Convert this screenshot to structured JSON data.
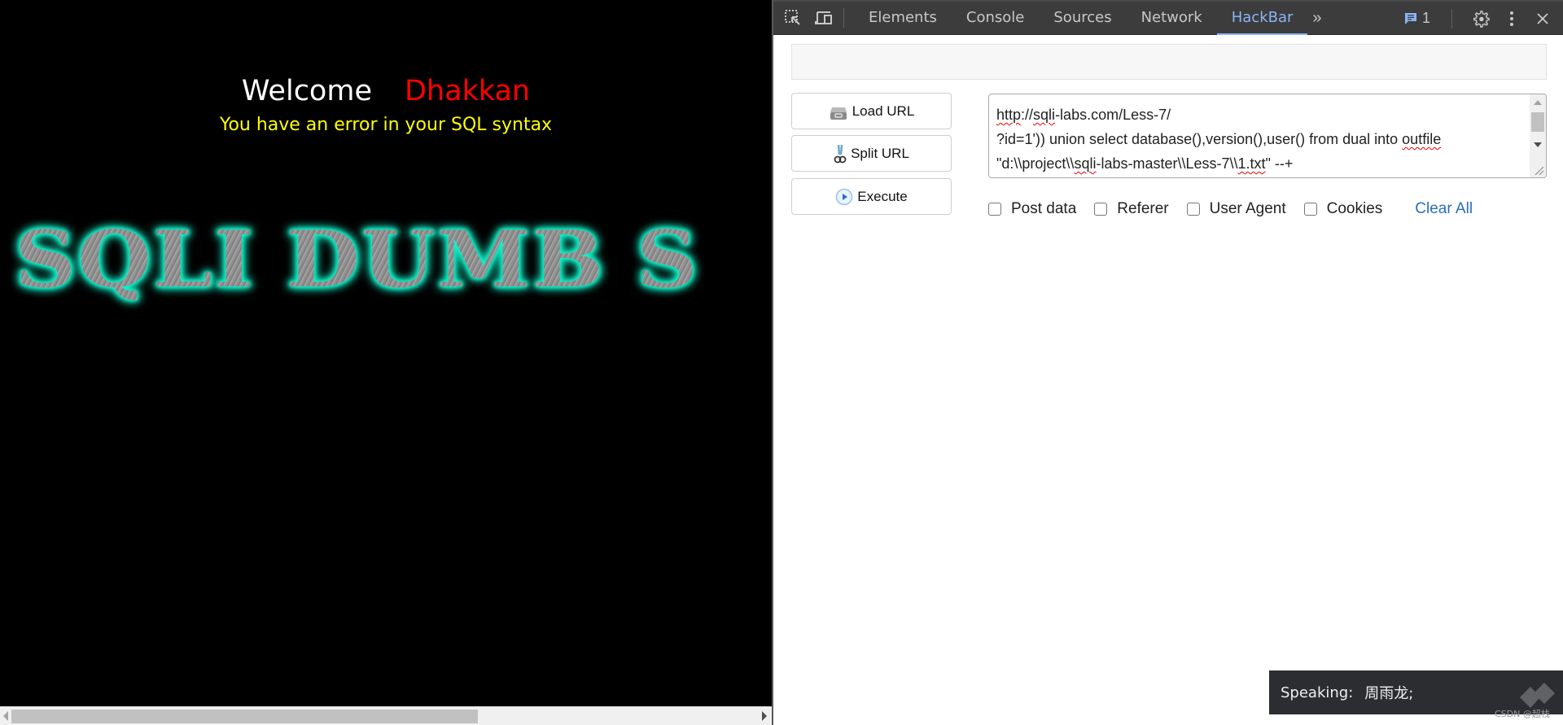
{
  "page": {
    "welcome_label": "Welcome",
    "welcome_name": "Dhakkan",
    "error_message": "You have an error in your SQL syntax",
    "banner_text": "SQLI DUMB S",
    "colors": {
      "welcome": "#ffffff",
      "name": "#ff0000",
      "error": "#ffff00",
      "banner_glow": "#1de9c4"
    }
  },
  "devtools": {
    "toolbar": {
      "inspect_icon": "inspect-element-icon",
      "device_icon": "device-toolbar-icon",
      "tabs": [
        {
          "label": "Elements",
          "active": false
        },
        {
          "label": "Console",
          "active": false
        },
        {
          "label": "Sources",
          "active": false
        },
        {
          "label": "Network",
          "active": false
        },
        {
          "label": "HackBar",
          "active": true
        }
      ],
      "more_tabs": "»",
      "issues_count": "1",
      "settings_icon": "gear-icon",
      "menu_icon": "kebab-menu-icon",
      "close_icon": "close-icon"
    },
    "hackbar": {
      "buttons": {
        "load_url": "Load URL",
        "split_url": "Split URL",
        "execute": "Execute"
      },
      "url_value": {
        "line1_a": "http",
        "line1_b": "://",
        "line1_c": "sqli",
        "line1_d": "-labs.com/Less-7/",
        "line2_a": "?id=1')) union select database(),version(),user() from dual into ",
        "line2_b": "outfile",
        "line3_a": "\"d:\\\\project\\\\",
        "line3_b": "sqli",
        "line3_c": "-labs-master\\\\Less-7\\\\",
        "line3_d": "1.txt",
        "line3_e": "\" --+"
      },
      "options": [
        {
          "label": "Post data",
          "checked": false
        },
        {
          "label": "Referer",
          "checked": false
        },
        {
          "label": "User Agent",
          "checked": false
        },
        {
          "label": "Cookies",
          "checked": false
        }
      ],
      "clear_all": "Clear All"
    }
  },
  "toast": {
    "label": "Speaking:",
    "value": "周雨龙;"
  },
  "watermark": "CSDN @超栈"
}
